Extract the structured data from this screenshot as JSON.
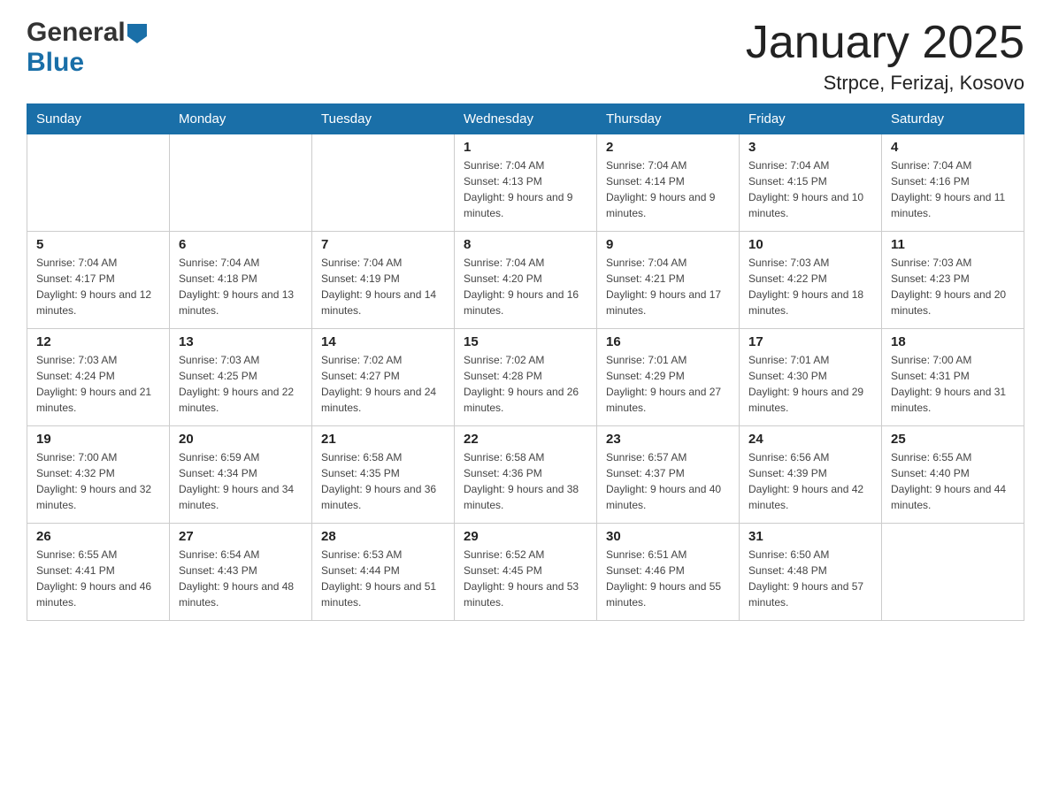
{
  "header": {
    "title": "January 2025",
    "subtitle": "Strpce, Ferizaj, Kosovo",
    "logo_general": "General",
    "logo_blue": "Blue"
  },
  "days_of_week": [
    "Sunday",
    "Monday",
    "Tuesday",
    "Wednesday",
    "Thursday",
    "Friday",
    "Saturday"
  ],
  "weeks": [
    [
      {
        "day": "",
        "info": ""
      },
      {
        "day": "",
        "info": ""
      },
      {
        "day": "",
        "info": ""
      },
      {
        "day": "1",
        "info": "Sunrise: 7:04 AM\nSunset: 4:13 PM\nDaylight: 9 hours and 9 minutes."
      },
      {
        "day": "2",
        "info": "Sunrise: 7:04 AM\nSunset: 4:14 PM\nDaylight: 9 hours and 9 minutes."
      },
      {
        "day": "3",
        "info": "Sunrise: 7:04 AM\nSunset: 4:15 PM\nDaylight: 9 hours and 10 minutes."
      },
      {
        "day": "4",
        "info": "Sunrise: 7:04 AM\nSunset: 4:16 PM\nDaylight: 9 hours and 11 minutes."
      }
    ],
    [
      {
        "day": "5",
        "info": "Sunrise: 7:04 AM\nSunset: 4:17 PM\nDaylight: 9 hours and 12 minutes."
      },
      {
        "day": "6",
        "info": "Sunrise: 7:04 AM\nSunset: 4:18 PM\nDaylight: 9 hours and 13 minutes."
      },
      {
        "day": "7",
        "info": "Sunrise: 7:04 AM\nSunset: 4:19 PM\nDaylight: 9 hours and 14 minutes."
      },
      {
        "day": "8",
        "info": "Sunrise: 7:04 AM\nSunset: 4:20 PM\nDaylight: 9 hours and 16 minutes."
      },
      {
        "day": "9",
        "info": "Sunrise: 7:04 AM\nSunset: 4:21 PM\nDaylight: 9 hours and 17 minutes."
      },
      {
        "day": "10",
        "info": "Sunrise: 7:03 AM\nSunset: 4:22 PM\nDaylight: 9 hours and 18 minutes."
      },
      {
        "day": "11",
        "info": "Sunrise: 7:03 AM\nSunset: 4:23 PM\nDaylight: 9 hours and 20 minutes."
      }
    ],
    [
      {
        "day": "12",
        "info": "Sunrise: 7:03 AM\nSunset: 4:24 PM\nDaylight: 9 hours and 21 minutes."
      },
      {
        "day": "13",
        "info": "Sunrise: 7:03 AM\nSunset: 4:25 PM\nDaylight: 9 hours and 22 minutes."
      },
      {
        "day": "14",
        "info": "Sunrise: 7:02 AM\nSunset: 4:27 PM\nDaylight: 9 hours and 24 minutes."
      },
      {
        "day": "15",
        "info": "Sunrise: 7:02 AM\nSunset: 4:28 PM\nDaylight: 9 hours and 26 minutes."
      },
      {
        "day": "16",
        "info": "Sunrise: 7:01 AM\nSunset: 4:29 PM\nDaylight: 9 hours and 27 minutes."
      },
      {
        "day": "17",
        "info": "Sunrise: 7:01 AM\nSunset: 4:30 PM\nDaylight: 9 hours and 29 minutes."
      },
      {
        "day": "18",
        "info": "Sunrise: 7:00 AM\nSunset: 4:31 PM\nDaylight: 9 hours and 31 minutes."
      }
    ],
    [
      {
        "day": "19",
        "info": "Sunrise: 7:00 AM\nSunset: 4:32 PM\nDaylight: 9 hours and 32 minutes."
      },
      {
        "day": "20",
        "info": "Sunrise: 6:59 AM\nSunset: 4:34 PM\nDaylight: 9 hours and 34 minutes."
      },
      {
        "day": "21",
        "info": "Sunrise: 6:58 AM\nSunset: 4:35 PM\nDaylight: 9 hours and 36 minutes."
      },
      {
        "day": "22",
        "info": "Sunrise: 6:58 AM\nSunset: 4:36 PM\nDaylight: 9 hours and 38 minutes."
      },
      {
        "day": "23",
        "info": "Sunrise: 6:57 AM\nSunset: 4:37 PM\nDaylight: 9 hours and 40 minutes."
      },
      {
        "day": "24",
        "info": "Sunrise: 6:56 AM\nSunset: 4:39 PM\nDaylight: 9 hours and 42 minutes."
      },
      {
        "day": "25",
        "info": "Sunrise: 6:55 AM\nSunset: 4:40 PM\nDaylight: 9 hours and 44 minutes."
      }
    ],
    [
      {
        "day": "26",
        "info": "Sunrise: 6:55 AM\nSunset: 4:41 PM\nDaylight: 9 hours and 46 minutes."
      },
      {
        "day": "27",
        "info": "Sunrise: 6:54 AM\nSunset: 4:43 PM\nDaylight: 9 hours and 48 minutes."
      },
      {
        "day": "28",
        "info": "Sunrise: 6:53 AM\nSunset: 4:44 PM\nDaylight: 9 hours and 51 minutes."
      },
      {
        "day": "29",
        "info": "Sunrise: 6:52 AM\nSunset: 4:45 PM\nDaylight: 9 hours and 53 minutes."
      },
      {
        "day": "30",
        "info": "Sunrise: 6:51 AM\nSunset: 4:46 PM\nDaylight: 9 hours and 55 minutes."
      },
      {
        "day": "31",
        "info": "Sunrise: 6:50 AM\nSunset: 4:48 PM\nDaylight: 9 hours and 57 minutes."
      },
      {
        "day": "",
        "info": ""
      }
    ]
  ]
}
